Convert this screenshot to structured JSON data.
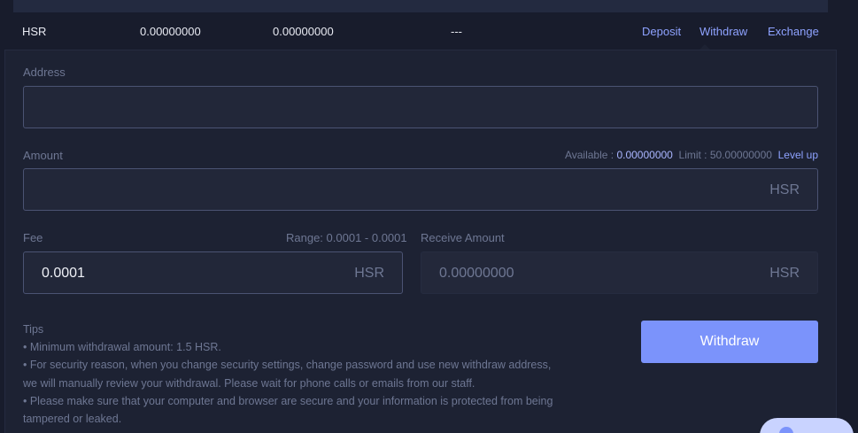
{
  "asset_row": {
    "symbol": "HSR",
    "total": "0.00000000",
    "available": "0.00000000",
    "value": "---",
    "actions": [
      "Deposit",
      "Withdraw",
      "Exchange"
    ]
  },
  "form": {
    "address_label": "Address",
    "address_value": "",
    "amount_label": "Amount",
    "amount_value": "",
    "amount_unit": "HSR",
    "available_label": "Available :",
    "available_value": "0.00000000",
    "limit_label": "Limit :",
    "limit_value": "50.00000000",
    "level_up": "Level up",
    "fee_label": "Fee",
    "fee_range": "Range: 0.0001 - 0.0001",
    "fee_value": "0.0001",
    "fee_unit": "HSR",
    "receive_label": "Receive Amount",
    "receive_value": "0.00000000",
    "receive_unit": "HSR",
    "submit_label": "Withdraw"
  },
  "tips": {
    "title": "Tips",
    "lines": [
      "• Minimum withdrawal amount: 1.5 HSR.",
      "• For security reason, when you change security settings, change password and use new withdraw address, we will manually review your withdrawal. Please wait for phone calls or emails from our staff.",
      "• Please make sure that your computer and browser are secure and your information is protected from being tampered or leaked."
    ]
  },
  "colors": {
    "accent": "#7b93fb",
    "link": "#8ea2ff",
    "background": "#181c2c",
    "panel": "#1d2233"
  },
  "icons": {
    "chat": "chat-icon"
  }
}
